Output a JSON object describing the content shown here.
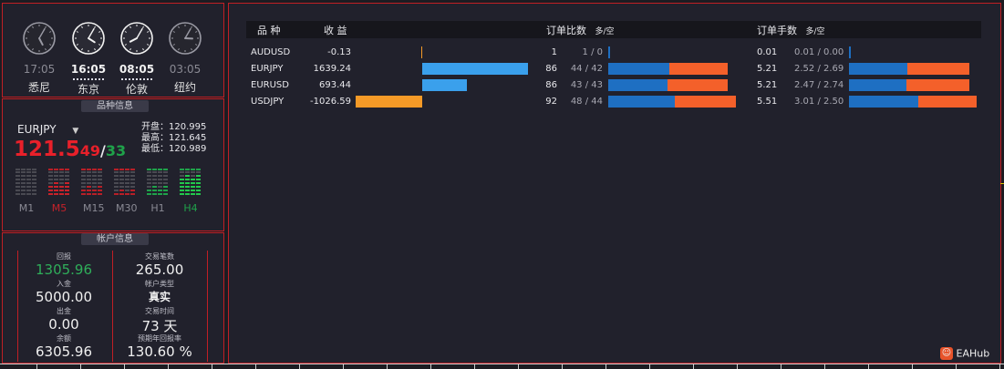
{
  "clocks": [
    {
      "time": "17:05",
      "city": "悉尼"
    },
    {
      "time": "16:05",
      "city": "东京"
    },
    {
      "time": "08:05",
      "city": "伦敦"
    },
    {
      "time": "03:05",
      "city": "纽约"
    }
  ],
  "symbol_info": {
    "title": "品种信息",
    "symbol": "EURJPY",
    "price_big": "121.5",
    "price_bid_tail": "49",
    "price_sep": "/",
    "price_ask_tail": "33",
    "open_label": "开盘：",
    "open": "120.995",
    "high_label": "最高：",
    "high": "121.645",
    "low_label": "最低：",
    "low": "120.989",
    "timeframes": [
      "M1",
      "M5",
      "M15",
      "M30",
      "H1",
      "H4"
    ]
  },
  "account": {
    "title": "帐户信息",
    "profit_label": "回报",
    "profit": "1305.96",
    "deposit_label": "入金",
    "deposit": "5000.00",
    "withdraw_label": "出金",
    "withdraw": "0.00",
    "balance_label": "余额",
    "balance": "6305.96",
    "trades_label": "交易笔数",
    "trades": "265.00",
    "type_label": "帐户类型",
    "type": "真实",
    "days_label": "交易时间",
    "days": "73 天",
    "annual_label": "预期年回报率",
    "annual": "130.60 %"
  },
  "table": {
    "headers": {
      "symbol": "品 种",
      "profit": "收 益",
      "order_ratio": "订单比数",
      "order_ratio_sub": "多/空",
      "lots": "订单手数",
      "lots_sub": "多/空"
    },
    "rows": [
      {
        "symbol": "AUDUSD",
        "profit": "-0.13",
        "profit_value": -0.13,
        "orders": "1",
        "orders_ls": "1 / 0",
        "long_orders": 1,
        "short_orders": 0,
        "lots": "0.01",
        "lots_ls": "0.01 / 0.00",
        "long_lots": 0.01,
        "short_lots": 0.0
      },
      {
        "symbol": "EURJPY",
        "profit": "1639.24",
        "profit_value": 1639.24,
        "orders": "86",
        "orders_ls": "44 / 42",
        "long_orders": 44,
        "short_orders": 42,
        "lots": "5.21",
        "lots_ls": "2.52 / 2.69",
        "long_lots": 2.52,
        "short_lots": 2.69
      },
      {
        "symbol": "EURUSD",
        "profit": "693.44",
        "profit_value": 693.44,
        "orders": "86",
        "orders_ls": "43 / 43",
        "long_orders": 43,
        "short_orders": 43,
        "lots": "5.21",
        "lots_ls": "2.47 / 2.74",
        "long_lots": 2.47,
        "short_lots": 2.74
      },
      {
        "symbol": "USDJPY",
        "profit": "-1026.59",
        "profit_value": -1026.59,
        "orders": "92",
        "orders_ls": "48 / 44",
        "long_orders": 48,
        "short_orders": 44,
        "lots": "5.51",
        "lots_ls": "3.01 / 2.50",
        "long_lots": 3.01,
        "short_lots": 2.5
      }
    ]
  },
  "watermark": "EAHub",
  "colors": {
    "border": "#c01f25",
    "long": "#1e6fc2",
    "short": "#f4602a",
    "bid": "#e8202a",
    "ask": "#1fa24a",
    "profit_green": "#2fae5a"
  }
}
